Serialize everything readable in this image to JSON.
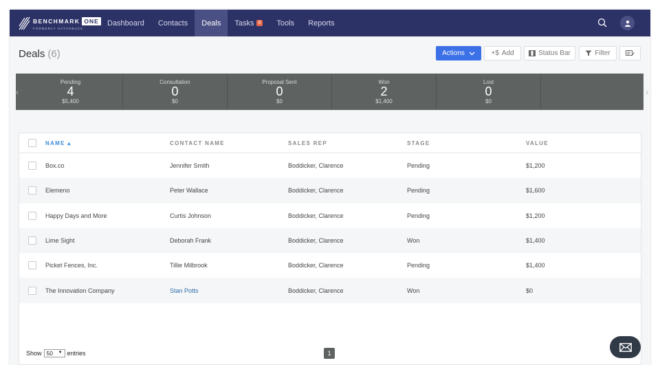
{
  "brand": {
    "word": "BENCHMARK",
    "one": "ONE",
    "sub": "FORMERLY HATCHBUCK"
  },
  "nav": [
    {
      "label": "Dashboard"
    },
    {
      "label": "Contacts"
    },
    {
      "label": "Deals"
    },
    {
      "label": "Tasks",
      "badge": "0"
    },
    {
      "label": "Tools"
    },
    {
      "label": "Reports"
    }
  ],
  "header": {
    "title": "Deals",
    "count": "(6)"
  },
  "toolbar": {
    "actions": "Actions",
    "add": "Add",
    "add_prefix": "+$",
    "status_bar": "Status Bar",
    "filter": "Filter"
  },
  "status_bar": [
    {
      "label": "Pending",
      "count": "4",
      "amount": "$5,400"
    },
    {
      "label": "Consultation",
      "count": "0",
      "amount": "$0"
    },
    {
      "label": "Proposal Sent",
      "count": "0",
      "amount": "$0"
    },
    {
      "label": "Won",
      "count": "2",
      "amount": "$1,400"
    },
    {
      "label": "Lost",
      "count": "0",
      "amount": "$0"
    },
    {
      "label": "",
      "count": "",
      "amount": ""
    }
  ],
  "table": {
    "columns": [
      "NAME ▴",
      "CONTACT NAME",
      "SALES REP",
      "STAGE",
      "VALUE"
    ],
    "rows": [
      [
        "Box.co",
        "Jennifer Smith",
        "Boddicker, Clarence",
        "Pending",
        "$1,200"
      ],
      [
        "Elemeno",
        "Peter Wallace",
        "Boddicker, Clarence",
        "Pending",
        "$1,600"
      ],
      [
        "Happy Days and More",
        "Curtis Johnson",
        "Boddicker, Clarence",
        "Pending",
        "$1,200"
      ],
      [
        "Lime Sight",
        "Deborah Frank",
        "Boddicker, Clarence",
        "Won",
        "$1,400"
      ],
      [
        "Picket Fences, Inc.",
        "Tillie Milbrook",
        "Boddicker, Clarence",
        "Pending",
        "$1,400"
      ],
      [
        "The Innovation Company",
        "Stan Potts",
        "Boddicker, Clarence",
        "Won",
        "$0"
      ]
    ]
  },
  "footer": {
    "show": "Show",
    "page_size": "50",
    "entries": "entries",
    "page": "1"
  },
  "colors": {
    "nav_bg": "#2c3166",
    "accent": "#3c70e6",
    "status_bg": "#5e6362",
    "link": "#2f6ea9"
  }
}
